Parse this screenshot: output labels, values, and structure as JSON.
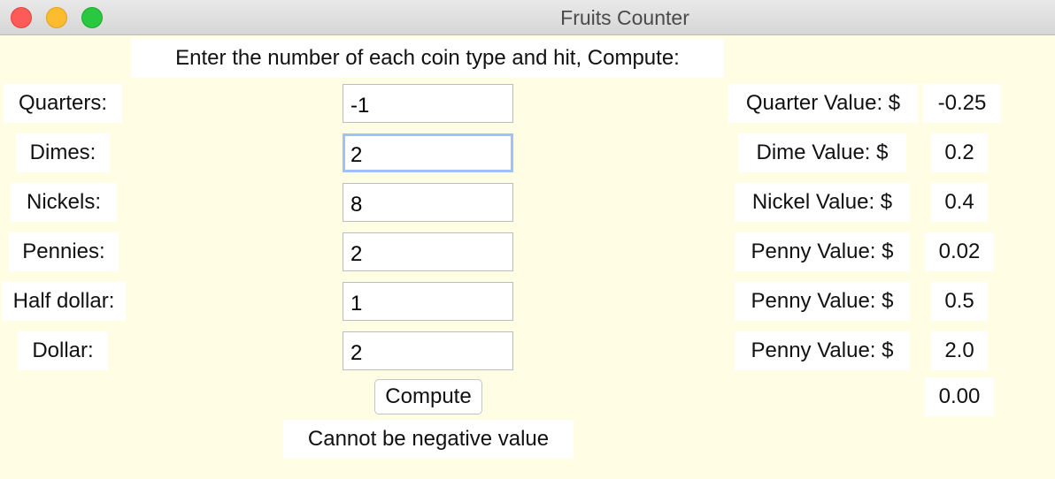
{
  "window": {
    "title": "Fruits Counter"
  },
  "instructions": "Enter the number of each coin type and hit, Compute:",
  "rows": [
    {
      "label": "Quarters:",
      "value": "-1",
      "result_label": "Quarter Value: $",
      "result": "-0.25"
    },
    {
      "label": "Dimes:",
      "value": "2",
      "result_label": "Dime Value: $",
      "result": "0.2"
    },
    {
      "label": "Nickels:",
      "value": "8",
      "result_label": "Nickel Value: $",
      "result": "0.4"
    },
    {
      "label": "Pennies:",
      "value": "2",
      "result_label": "Penny Value: $",
      "result": "0.02"
    },
    {
      "label": "Half dollar:",
      "value": "1",
      "result_label": "Penny Value: $",
      "result": "0.5"
    },
    {
      "label": "Dollar:",
      "value": "2",
      "result_label": "Penny Value: $",
      "result": "2.0"
    }
  ],
  "compute_label": "Compute",
  "total": "0.00",
  "status": "Cannot be negative value",
  "colors": {
    "background": "#fffde3",
    "focus_ring": "#9cc3f3",
    "close": "#fd5b57",
    "minimize": "#fdbc2e",
    "maximize": "#28c840"
  }
}
